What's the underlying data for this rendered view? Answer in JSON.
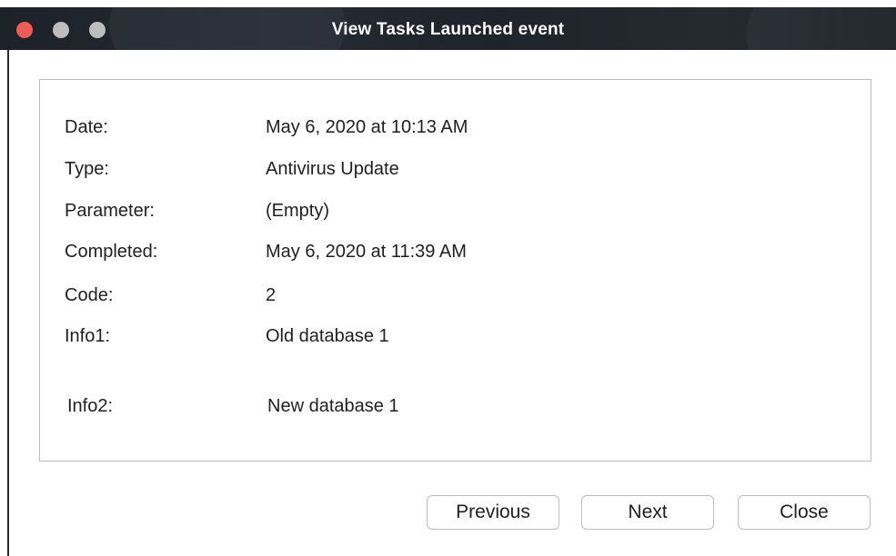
{
  "window": {
    "title": "View Tasks Launched event"
  },
  "details": {
    "rows": [
      {
        "label": "Date:",
        "value": "May 6, 2020 at 10:13 AM"
      },
      {
        "label": "Type:",
        "value": "Antivirus Update"
      },
      {
        "label": "Parameter:",
        "value": "(Empty)"
      },
      {
        "label": "Completed:",
        "value": "May 6, 2020 at 11:39 AM"
      },
      {
        "label": "Code:",
        "value": "2"
      },
      {
        "label": "Info1:",
        "value": "Old database 1"
      },
      {
        "label": "Info2:",
        "value": "New database 1"
      }
    ]
  },
  "buttons": {
    "previous": "Previous",
    "next": "Next",
    "close": "Close"
  },
  "colors": {
    "titlebar": "#1f232b",
    "close_light": "#ee5c52",
    "inactive_light": "#bdbdbd"
  }
}
